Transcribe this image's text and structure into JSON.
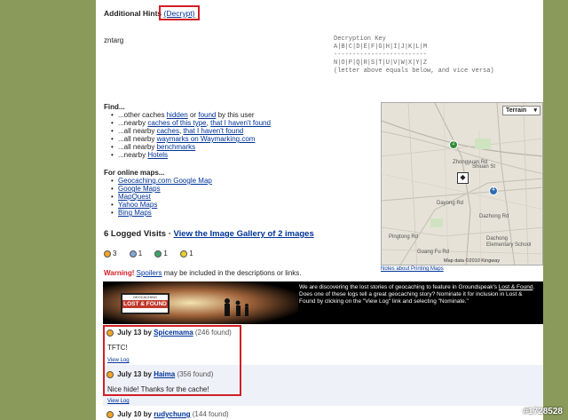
{
  "hints": {
    "label": "Additional Hints",
    "decrypt_link": "(Decrypt)",
    "encoded_text": "zntarg",
    "key_title": "Decryption Key",
    "key_row1": "A|B|C|D|E|F|G|H|I|J|K|L|M",
    "key_sep": "-------------------------",
    "key_row2": "N|O|P|Q|R|S|T|U|V|W|X|Y|Z",
    "key_note": "(letter above equals below, and vice versa)"
  },
  "find": {
    "heading": "Find...",
    "items": [
      {
        "prefix": "...other caches",
        "links": [
          "hidden",
          "found"
        ],
        "joiner": "or",
        "suffix": "by this user"
      },
      {
        "prefix": "...nearby",
        "links": [
          "caches of this type",
          "that I haven't found"
        ],
        "joiner": ",",
        "suffix": ""
      },
      {
        "prefix": "...all nearby",
        "links": [
          "caches",
          "that I haven't found"
        ],
        "joiner": ",",
        "suffix": ""
      },
      {
        "prefix": "...all nearby",
        "links": [
          "waymarks on Waymarking.com"
        ],
        "joiner": "",
        "suffix": ""
      },
      {
        "prefix": "...all nearby",
        "links": [
          "benchmarks"
        ],
        "joiner": "",
        "suffix": ""
      },
      {
        "prefix": "...nearby",
        "links": [
          "Hotels"
        ],
        "joiner": "",
        "suffix": ""
      }
    ]
  },
  "online_maps": {
    "heading": "For online maps...",
    "links": [
      "Geocaching.com Google Map",
      "Google Maps",
      "MapQuest",
      "Yahoo Maps",
      "Bing Maps"
    ]
  },
  "map": {
    "type_select": "Terrain",
    "attribution": "Map data ©2010 Kingway",
    "notes_link": "Notes about Printing Maps",
    "labels": [
      "Zhongyuan Rd",
      "Shiuan St",
      "Guang Fu Rd",
      "Dazhong Rd",
      "Dachong Elementary School",
      "Pingtong Rd",
      "Dayong Rd"
    ],
    "markers": [
      "2",
      "4"
    ]
  },
  "logs_summary": {
    "count_text": "6 Logged Visits",
    "separator": "·",
    "gallery_link": "View the Image Gallery of 2 images",
    "icons": [
      {
        "name": "found-smiley-icon",
        "count": "3",
        "color": "#f2a623"
      },
      {
        "name": "didnt-find-icon",
        "count": "1",
        "color": "#7fa7d9"
      },
      {
        "name": "write-note-icon",
        "count": "1",
        "color": "#3aa56b"
      },
      {
        "name": "needs-maintenance-icon",
        "count": "1",
        "color": "#e8d12a"
      }
    ]
  },
  "warning": {
    "label": "Warning!",
    "link": "Spoilers",
    "text": "may be included in the descriptions or links."
  },
  "banner": {
    "logo_top": "GEOCACHING",
    "logo_main": "LOST & FOUND",
    "text_before": "We are discovering the lost stories of geocaching to feature in Groundspeak's",
    "text_link": "Lost & Found",
    "text_after": ". Does one of these logs tell a great geocaching story? Nominate it for inclusion in Lost & Found by clicking on the \"View Log\" link and selecting \"Nominate.\""
  },
  "logs": [
    {
      "date": "July 13",
      "by": "by",
      "user": "Spicemama",
      "count": "(246 found)",
      "text": "TFTC!",
      "view": "View Log"
    },
    {
      "date": "July 13",
      "by": "by",
      "user": "Haima",
      "count": "(356 found)",
      "text": "Nice hide! Thanks for the cache!",
      "view": "View Log"
    },
    {
      "date": "July 10",
      "by": "by",
      "user": "rudychung",
      "count": "(144 found)",
      "text": "",
      "view": ""
    }
  ],
  "watermark": "#1728528"
}
